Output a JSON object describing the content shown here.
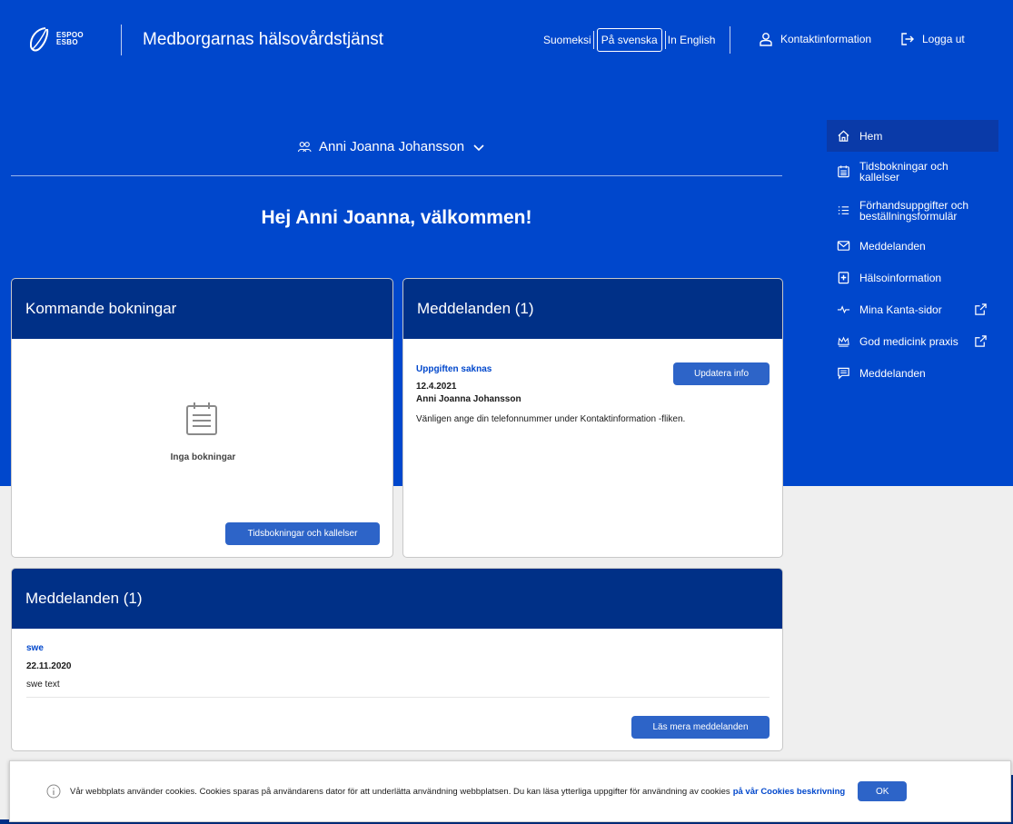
{
  "header": {
    "logo_text_1": "ESPOO",
    "logo_text_2": "ESBO",
    "title": "Medborgarnas hälsovårdstjänst",
    "languages": [
      {
        "label": "Suomeksi",
        "active": false
      },
      {
        "label": "På svenska",
        "active": true
      },
      {
        "label": "In English",
        "active": false
      }
    ],
    "contact_label": "Kontaktinformation",
    "logout_label": "Logga ut"
  },
  "user": {
    "name": "Anni Joanna Johansson"
  },
  "welcome": "Hej Anni Joanna, välkommen!",
  "nav": {
    "items": [
      {
        "label": "Hem",
        "icon": "home-icon",
        "active": true
      },
      {
        "label": "Tidsbokningar och kallelser",
        "icon": "calendar-icon"
      },
      {
        "label": "Förhandsuppgifter och beställningsformulär",
        "icon": "list-icon"
      },
      {
        "label": "Meddelanden",
        "icon": "envelope-icon"
      },
      {
        "label": "Hälsoinformation",
        "icon": "health-record-icon"
      },
      {
        "label": "Mina Kanta-sidor",
        "icon": "pulse-icon",
        "external": true
      },
      {
        "label": "God medicink praxis",
        "icon": "crown-icon",
        "external": true
      },
      {
        "label": "Meddelanden",
        "icon": "chat-icon"
      }
    ]
  },
  "bookings_card": {
    "title": "Kommande bokningar",
    "empty_text": "Inga bokningar",
    "button": "Tidsbokningar och kallelser"
  },
  "messages_card": {
    "title": "Meddelanden (1)",
    "item_title": "Uppgiften saknas",
    "date": "12.4.2021",
    "sender": "Anni Joanna Johansson",
    "text": "Vänligen ange din telefonnummer under Kontaktinformation -fliken.",
    "button": "Updatera info"
  },
  "announcements_card": {
    "title": "Meddelanden (1)",
    "item_title": "swe",
    "date": "22.11.2020",
    "text": "swe text",
    "button": "Läs mera meddelanden"
  },
  "cookie": {
    "text": "Vår webbplats använder cookies. Cookies sparas på användarens dator för att underlätta användning webbplatsen. Du kan läsa ytterliga uppgifter för användning av cookies",
    "link": "på vår Cookies beskrivning",
    "ok": "OK"
  },
  "colors": {
    "brand_blue": "#0047cc",
    "card_header": "#003087",
    "button": "#2d64c8"
  }
}
